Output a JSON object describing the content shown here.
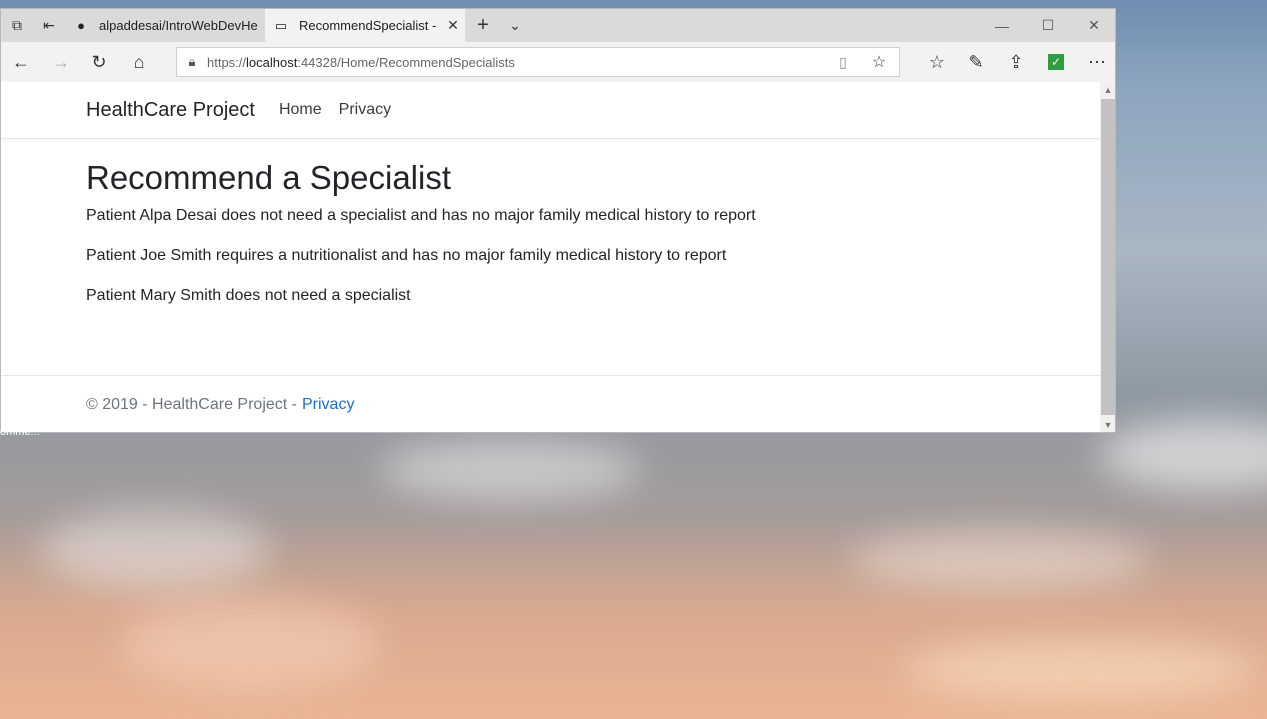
{
  "browser": {
    "tabs": [
      {
        "label": "alpaddesai/IntroWebDevHe",
        "icon": "github-icon"
      },
      {
        "label": "RecommendSpecialist -",
        "icon": "page-icon"
      }
    ],
    "address": {
      "scheme": "https://",
      "host": "localhost",
      "rest": ":44328/Home/RecommendSpecialists"
    },
    "status_text": "omme..."
  },
  "site": {
    "brand": "HealthCare Project",
    "nav": [
      "Home",
      "Privacy"
    ]
  },
  "main": {
    "heading": "Recommend a Specialist",
    "patients": [
      "Patient Alpa Desai does not need a specialist and has no major family medical history to report",
      "Patient Joe Smith requires a nutritionalist and has no major family medical history to report",
      "Patient Mary Smith does not need a specialist"
    ]
  },
  "footer": {
    "text": "© 2019 - HealthCare Project -",
    "link": "Privacy"
  },
  "colors": {
    "link": "#1b6ec2",
    "text": "#212529",
    "muted": "#6c757d"
  }
}
